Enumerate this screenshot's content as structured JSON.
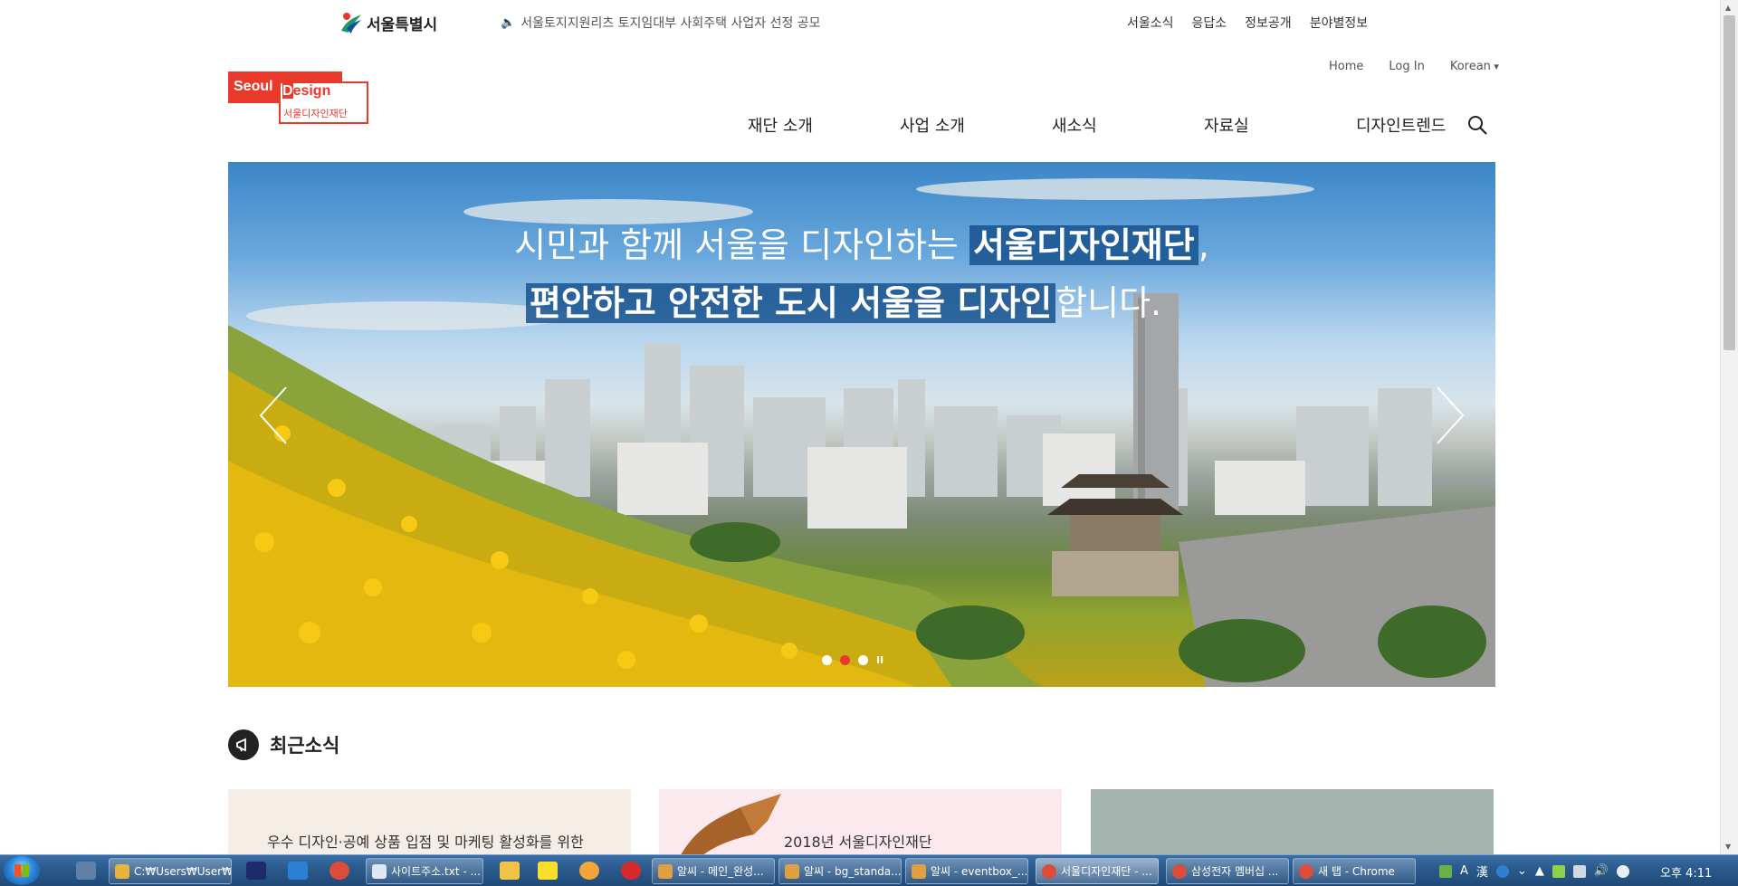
{
  "topbar": {
    "seoul_logo": "서울특별시",
    "notice": "서울토지지원리츠 토지임대부 사회주택 사업자 선정 공모",
    "links": [
      "서울소식",
      "응답소",
      "정보공개",
      "분야별정보"
    ]
  },
  "header": {
    "logo": {
      "word1": "Seoul",
      "word2_first": "D",
      "word2_rest": "esign",
      "sub": "서울디자인재단"
    },
    "member_links": {
      "home": "Home",
      "login": "Log In",
      "lang": "Korean"
    },
    "nav": [
      "재단 소개",
      "사업 소개",
      "새소식",
      "자료실",
      "디자인트렌드"
    ]
  },
  "hero": {
    "line1_prefix": "시민과 함께 서울을 디자인하는 ",
    "line1_highlight": "서울디자인재단",
    "line1_suffix": ",",
    "line2_highlight": "편안하고 안전한 도시 서울을 디자인",
    "line2_suffix": "합니다.",
    "pause_label": "II",
    "slide_count": 3,
    "active_slide": 2
  },
  "news": {
    "title": "최근소식",
    "cards": [
      {
        "title": "우수 디자인·공예 상품 입점 및 마케팅 활성화를 위한"
      },
      {
        "title": "2018년 서울디자인재단"
      },
      {
        "title": ""
      }
    ]
  },
  "taskbar": {
    "tasks": [
      "C:₩Users₩User₩...",
      "사이트주소.txt - ...",
      "알씨 - 메인_완성...",
      "알씨 - bg_standa...",
      "알씨 - eventbox_...",
      "서울디자인재단 - ...",
      "삼성전자 멤버십 ...",
      "새 탭 - Chrome"
    ],
    "ime_a": "A",
    "ime_han": "漢",
    "clock": "오후 4:11"
  },
  "colors": {
    "accent": "#e8392b",
    "highlight": "#18528e",
    "taskbar": "#2a5a8c"
  }
}
